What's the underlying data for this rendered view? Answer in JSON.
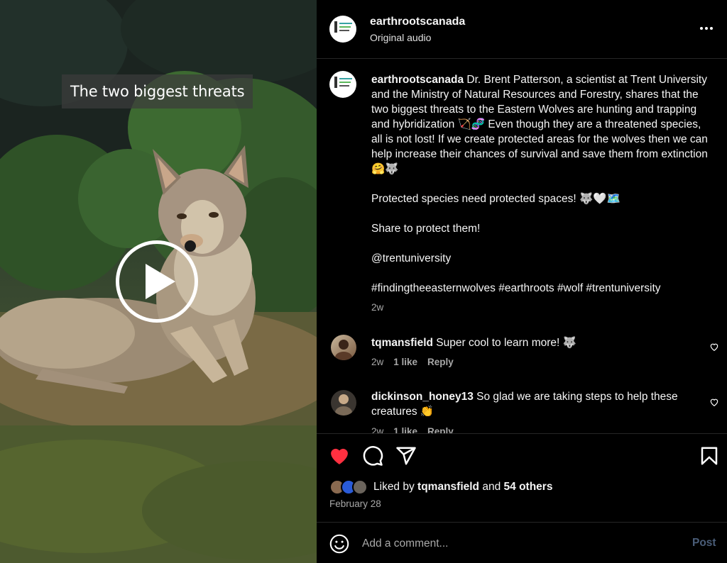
{
  "media": {
    "overlay_caption": "The two biggest threats",
    "play_button": "play-icon"
  },
  "header": {
    "username": "earthrootscanada",
    "audio": "Original audio",
    "more_icon": "more-horizontal-icon"
  },
  "caption": {
    "username": "earthrootscanada",
    "text": "Dr. Brent Patterson, a scientist at Trent University and the Ministry of Natural Resources and Forestry, shares that the two biggest threats to the Eastern Wolves are hunting and trapping and hybridization 🏹🧬 Even though they are a threatened species, all is not lost! If we create protected areas for the wolves then we can help increase their chances of survival and save them from extinction 🤗🐺",
    "line2": "Protected species need protected spaces! 🐺🤍🗺️",
    "line3": "Share to protect them!",
    "mention": "@trentuniversity",
    "hashtags": "#findingtheeasternwolves #earthroots #wolf #trentuniversity",
    "time": "2w"
  },
  "comments": [
    {
      "username": "tqmansfield",
      "text": "Super cool to learn more! 🐺",
      "time": "2w",
      "likes": "1 like",
      "reply": "Reply"
    },
    {
      "username": "dickinson_honey13",
      "text": "So glad we are taking steps to help these creatures 👏",
      "time": "2w",
      "likes": "1 like",
      "reply": "Reply"
    }
  ],
  "actions": {
    "like_icon": "heart-filled-icon",
    "comment_icon": "comment-icon",
    "share_icon": "send-icon",
    "save_icon": "bookmark-icon",
    "like_color": "#ff3040"
  },
  "likes": {
    "prefix": "Liked by",
    "user": "tqmansfield",
    "and": "and",
    "others": "54 others"
  },
  "date": "February 28",
  "comment_box": {
    "placeholder": "Add a comment...",
    "post_label": "Post",
    "emoji_icon": "emoji-smile-icon"
  }
}
